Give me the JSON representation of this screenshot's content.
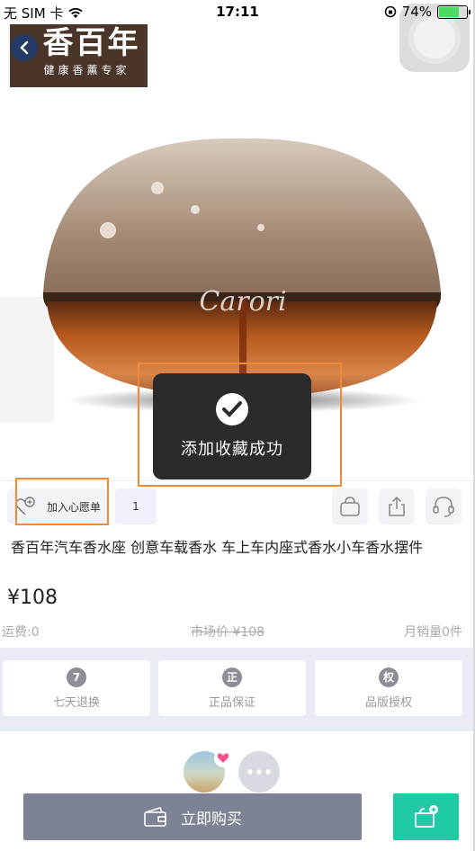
{
  "status_bar": {
    "carrier": "无 SIM 卡",
    "time": "17:11",
    "battery": "74%",
    "battery_level": 0.74
  },
  "logo": {
    "main": "香百年",
    "sub": "健康香薰专家"
  },
  "product_image": {
    "brand_script": "Carori"
  },
  "toast": {
    "text": "添加收藏成功"
  },
  "actions": {
    "wish_label": "加入心愿单",
    "wish_count": "1"
  },
  "product": {
    "title": "香百年汽车香水座 创意车载香水 车上车内座式香水小车香水摆件",
    "price": "¥108",
    "shipping": "运费:0",
    "market_price": "市场价 ¥108",
    "monthly_sales": "月销量0件"
  },
  "guarantees": [
    {
      "badge": "7",
      "label": "七天退换"
    },
    {
      "badge": "正",
      "label": "正品保证"
    },
    {
      "badge": "权",
      "label": "品版授权"
    }
  ],
  "bottom": {
    "buy_label": "立即购买"
  },
  "colors": {
    "accent_green": "#1fcaa7",
    "buy_gray": "#7d8395",
    "highlight_orange": "#f08a3a"
  }
}
